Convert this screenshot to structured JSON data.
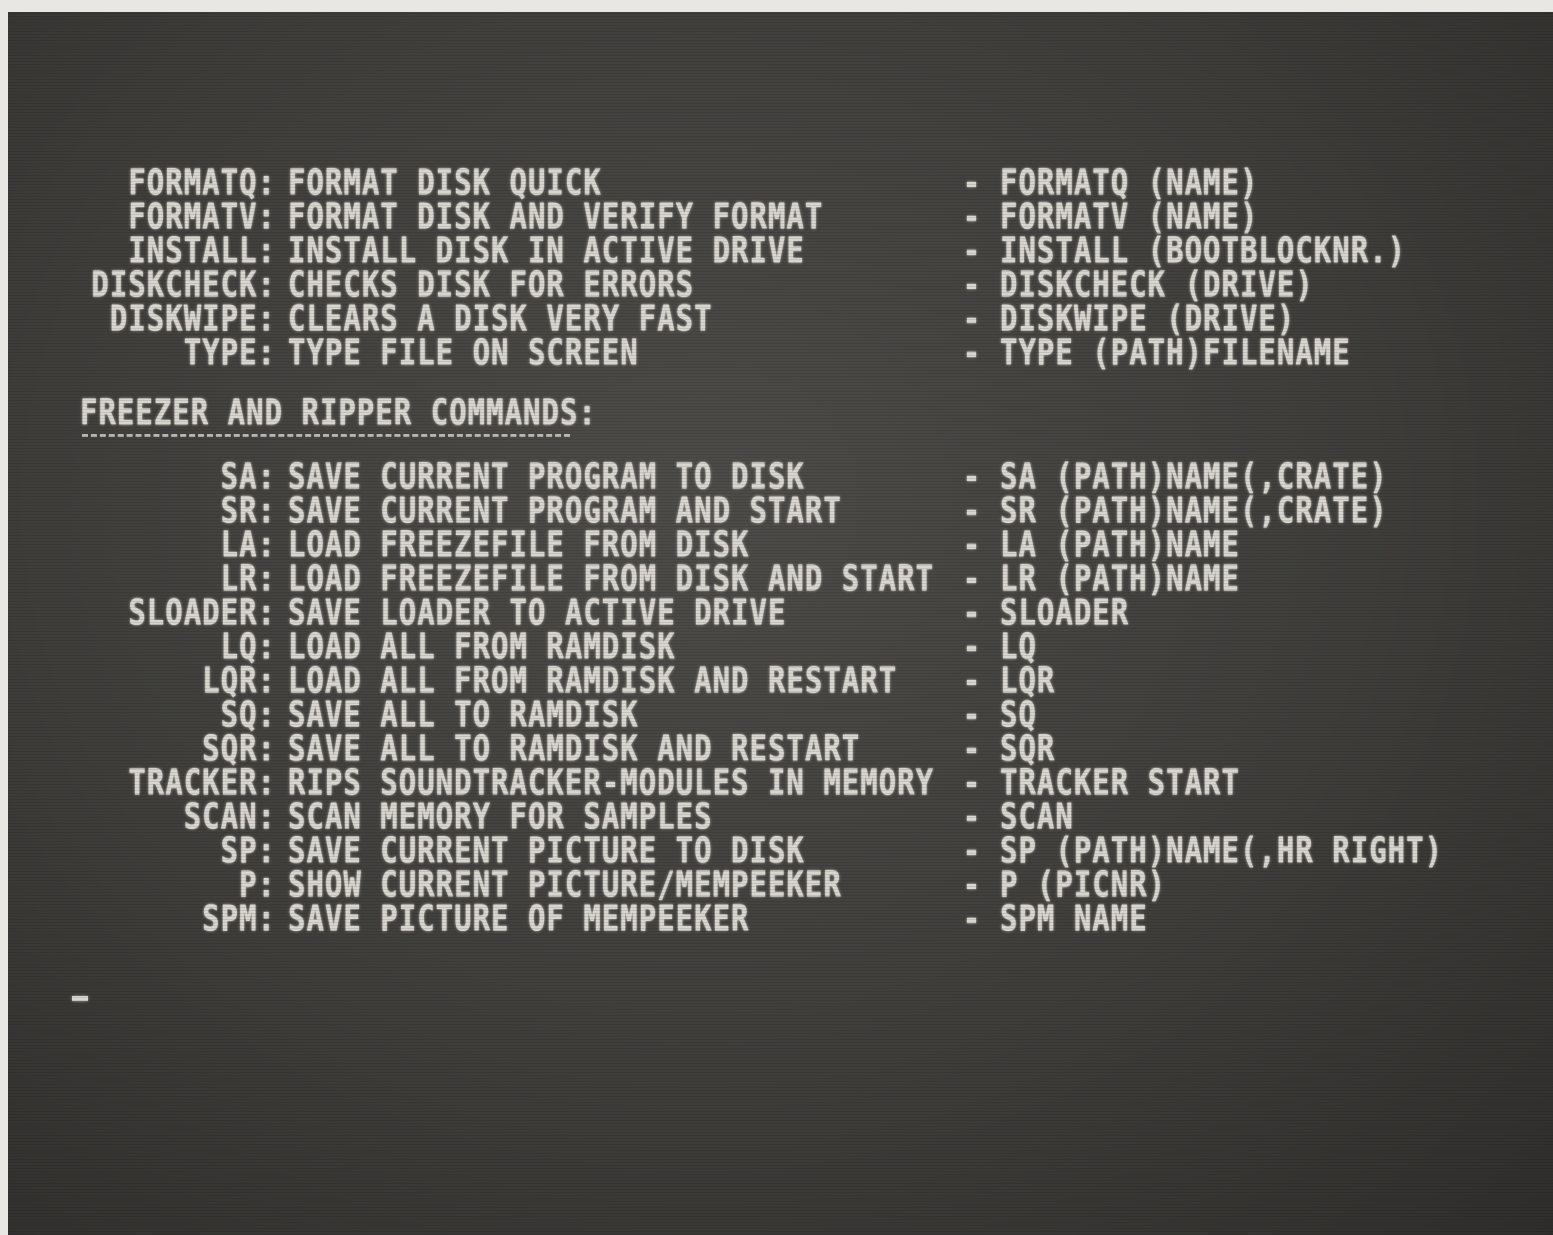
{
  "disk_commands": [
    {
      "cmd": "FORMATQ:",
      "desc": "FORMAT DISK QUICK",
      "usage": "FORMATQ (NAME)"
    },
    {
      "cmd": "FORMATV:",
      "desc": "FORMAT DISK AND VERIFY FORMAT",
      "usage": "FORMATV (NAME)"
    },
    {
      "cmd": "INSTALL:",
      "desc": "INSTALL DISK IN ACTIVE DRIVE",
      "usage": "INSTALL (BOOTBLOCKNR.)"
    },
    {
      "cmd": "DISKCHECK:",
      "desc": "CHECKS DISK FOR ERRORS",
      "usage": "DISKCHECK (DRIVE)"
    },
    {
      "cmd": "DISKWIPE:",
      "desc": "CLEARS A DISK VERY FAST",
      "usage": "DISKWIPE (DRIVE)"
    },
    {
      "cmd": "TYPE:",
      "desc": "TYPE FILE ON SCREEN",
      "usage": "TYPE (PATH)FILENAME"
    }
  ],
  "section_heading": "FREEZER AND RIPPER COMMANDS:",
  "freezer_commands": [
    {
      "cmd": "SA:",
      "desc": "SAVE CURRENT PROGRAM TO DISK",
      "usage": "SA (PATH)NAME(,CRATE)"
    },
    {
      "cmd": "SR:",
      "desc": "SAVE CURRENT PROGRAM AND START",
      "usage": "SR (PATH)NAME(,CRATE)"
    },
    {
      "cmd": "LA:",
      "desc": "LOAD FREEZEFILE FROM DISK",
      "usage": "LA (PATH)NAME"
    },
    {
      "cmd": "LR:",
      "desc": "LOAD FREEZEFILE FROM DISK AND START",
      "usage": "LR (PATH)NAME"
    },
    {
      "cmd": "SLOADER:",
      "desc": "SAVE LOADER TO ACTIVE DRIVE",
      "usage": "SLOADER"
    },
    {
      "cmd": "LQ:",
      "desc": "LOAD ALL FROM RAMDISK",
      "usage": "LQ"
    },
    {
      "cmd": "LQR:",
      "desc": "LOAD ALL FROM RAMDISK AND RESTART",
      "usage": "LQR"
    },
    {
      "cmd": "SQ:",
      "desc": "SAVE ALL TO RAMDISK",
      "usage": "SQ"
    },
    {
      "cmd": "SQR:",
      "desc": "SAVE ALL TO RAMDISK AND RESTART",
      "usage": "SQR"
    },
    {
      "cmd": "TRACKER:",
      "desc": "RIPS SOUNDTRACKER-MODULES IN MEMORY",
      "usage": "TRACKER START"
    },
    {
      "cmd": "SCAN:",
      "desc": "SCAN MEMORY FOR SAMPLES",
      "usage": "SCAN"
    },
    {
      "cmd": "SP:",
      "desc": "SAVE CURRENT PICTURE TO DISK",
      "usage": "SP (PATH)NAME(,HR RIGHT)"
    },
    {
      "cmd": "P:",
      "desc": "SHOW CURRENT PICTURE/MEMPEEKER",
      "usage": "P (PICNR)"
    },
    {
      "cmd": "SPM:",
      "desc": "SAVE PICTURE OF MEMPEEKER",
      "usage": "SPM NAME"
    }
  ],
  "separator": "-"
}
